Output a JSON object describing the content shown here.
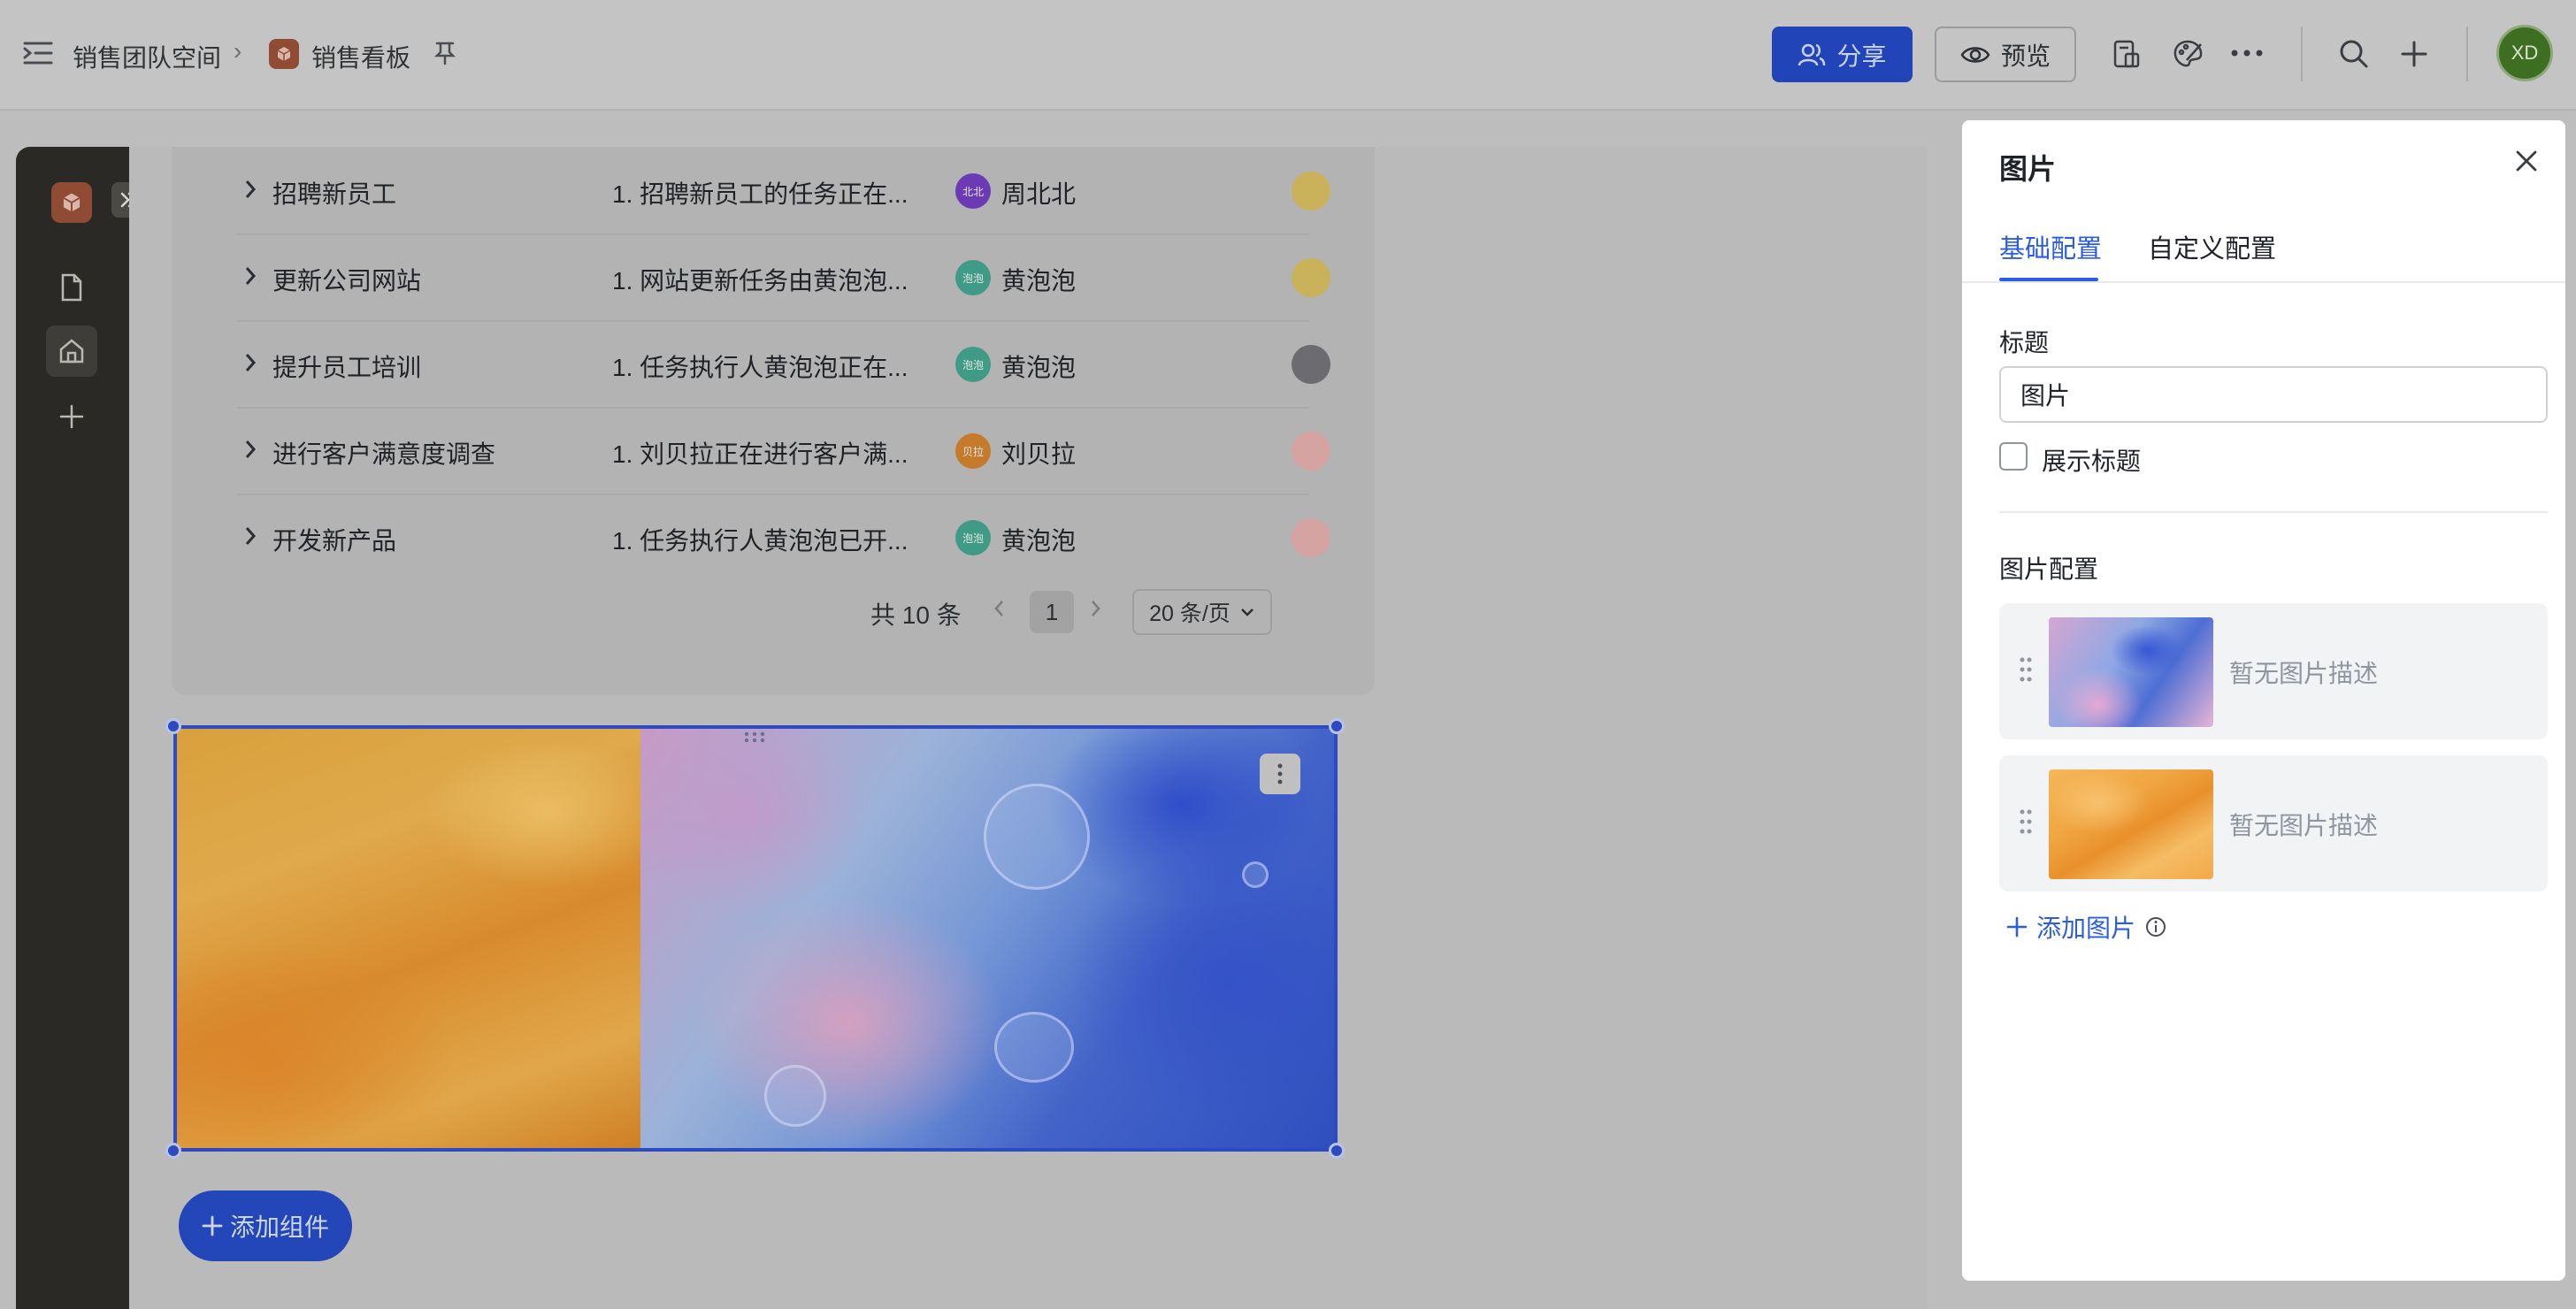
{
  "topbar": {
    "breadcrumb_space": "销售团队空间",
    "breadcrumb_sep": "›",
    "page_title": "销售看板",
    "share_label": "分享",
    "preview_label": "预览",
    "user_initials": "XD"
  },
  "table": {
    "rows": [
      {
        "title": "招聘新员工",
        "desc": "1. 招聘新员工的任务正在...",
        "person": "周北北",
        "avatar_text": "北北",
        "avatar_color": "#6b3ab5",
        "dot_color": "#c9b25a"
      },
      {
        "title": "更新公司网站",
        "desc": "1. 网站更新任务由黄泡泡...",
        "person": "黄泡泡",
        "avatar_text": "泡泡",
        "avatar_color": "#3f9a86",
        "dot_color": "#c9b25a"
      },
      {
        "title": "提升员工培训",
        "desc": "1. 任务执行人黄泡泡正在...",
        "person": "黄泡泡",
        "avatar_text": "泡泡",
        "avatar_color": "#3f9a86",
        "dot_color": "#6c6c70"
      },
      {
        "title": "进行客户满意度调查",
        "desc": "1. 刘贝拉正在进行客户满...",
        "person": "刘贝拉",
        "avatar_text": "贝拉",
        "avatar_color": "#c67a2c",
        "dot_color": "#d6a3a3"
      },
      {
        "title": "开发新产品",
        "desc": "1. 任务执行人黄泡泡已开...",
        "person": "黄泡泡",
        "avatar_text": "泡泡",
        "avatar_color": "#3f9a86",
        "dot_color": "#d6a3a3"
      }
    ],
    "pagination": {
      "total": "共 10 条",
      "current_page": "1",
      "page_size": "20 条/页"
    }
  },
  "canvas": {
    "add_component_label": "添加组件"
  },
  "panel": {
    "title": "图片",
    "tabs": [
      {
        "label": "基础配置",
        "active": true
      },
      {
        "label": "自定义配置",
        "active": false
      }
    ],
    "title_label": "标题",
    "title_value": "图片",
    "show_title_label": "展示标题",
    "show_title_checked": false,
    "image_config_label": "图片配置",
    "images": [
      {
        "desc": "暂无图片描述",
        "thumb": "blue-marble"
      },
      {
        "desc": "暂无图片描述",
        "thumb": "orange-marble"
      }
    ],
    "add_image_label": "添加图片"
  },
  "colors": {
    "accent": "#2b5ce6",
    "share_button": "#2145b8",
    "rail_bg": "#2a2925"
  }
}
